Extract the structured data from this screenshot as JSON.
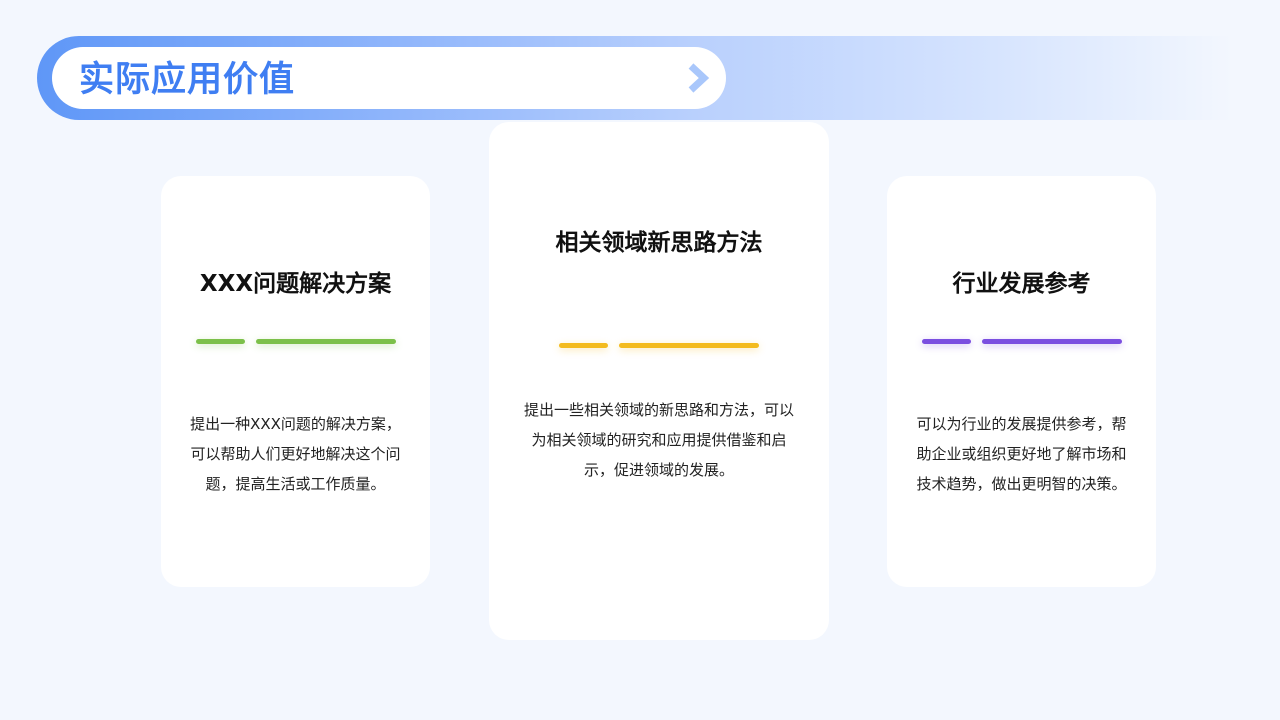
{
  "header": {
    "title": "实际应用价值"
  },
  "cards": [
    {
      "title": "XXX问题解决方案",
      "description": "提出一种XXX问题的解决方案，可以帮助人们更好地解决这个问题，提高生活或工作质量。",
      "accent_color": "#7cc04a"
    },
    {
      "title": "相关领域新思路方法",
      "description": "提出一些相关领域的新思路和方法，可以为相关领域的研究和应用提供借鉴和启示，促进领域的发展。",
      "accent_color": "#f3bb1f"
    },
    {
      "title": "行业发展参考",
      "description": "可以为行业的发展提供参考，帮助企业或组织更好地了解市场和技术趋势，做出更明智的决策。",
      "accent_color": "#7b4fe0"
    }
  ],
  "colors": {
    "primary": "#3f7ef2",
    "background": "#f3f7fe",
    "card": "#ffffff"
  },
  "icons": {
    "header_arrow": "chevron-right-icon"
  }
}
